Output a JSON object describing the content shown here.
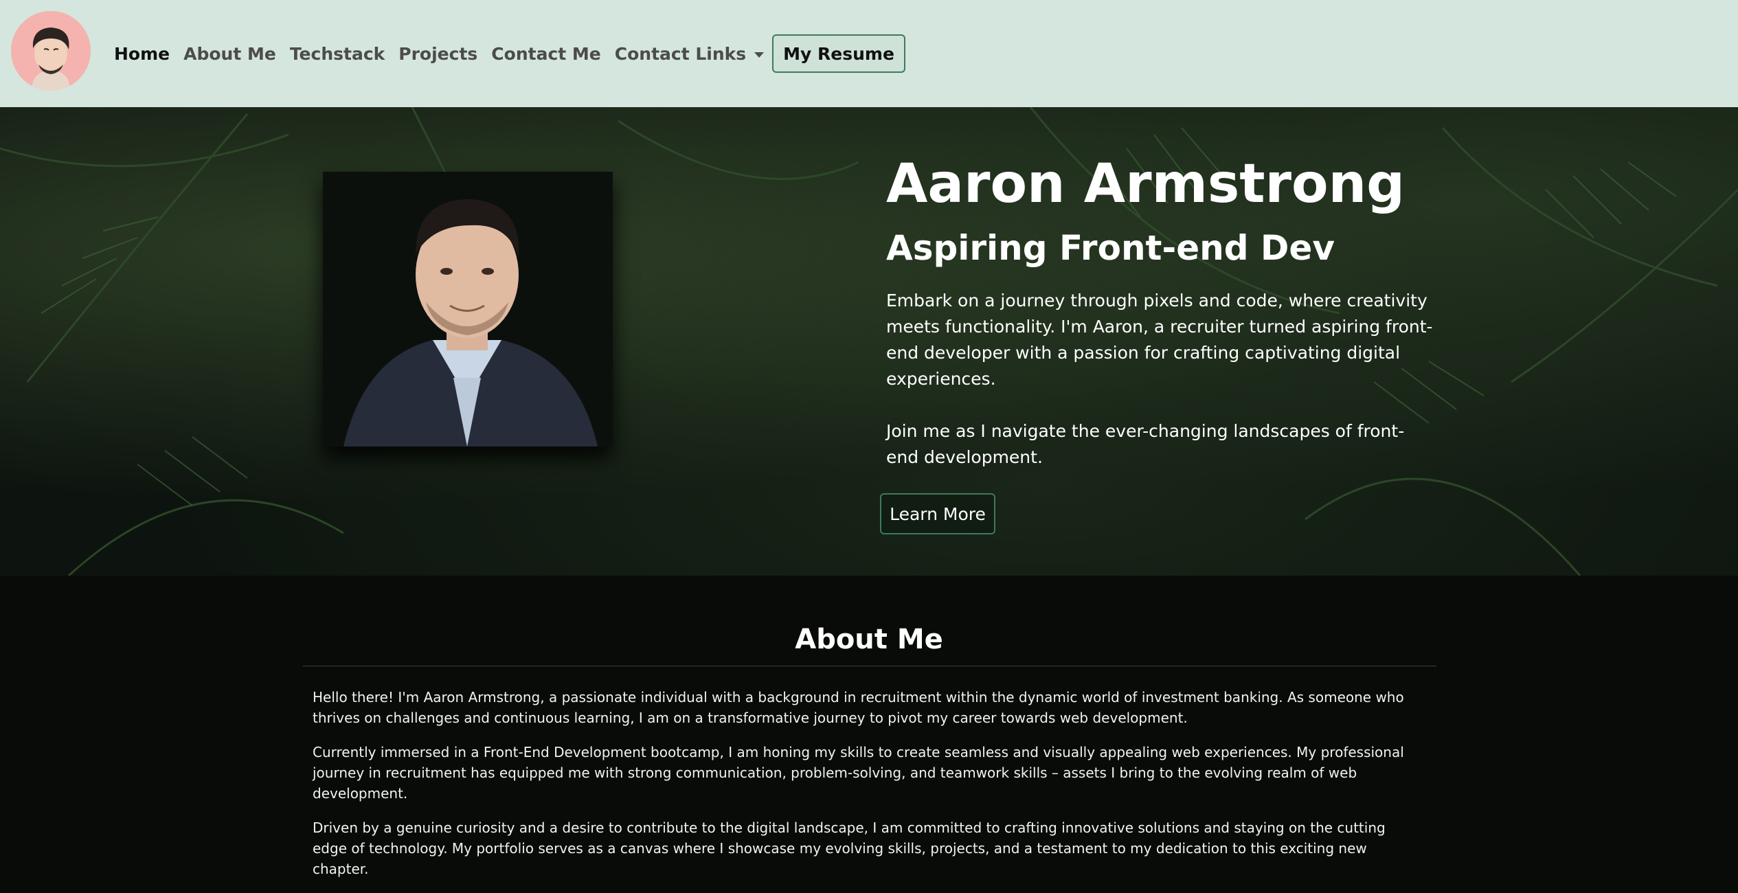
{
  "nav": {
    "avatar_icon": "memoji-avatar-icon",
    "links": [
      {
        "label": "Home",
        "active": true
      },
      {
        "label": "About Me"
      },
      {
        "label": "Techstack"
      },
      {
        "label": "Projects"
      },
      {
        "label": "Contact Me"
      }
    ],
    "dropdown_label": "Contact Links",
    "resume_label": "My Resume"
  },
  "hero": {
    "name": "Aaron Armstrong",
    "title": "Aspiring Front-end Dev",
    "intro": "Embark on a journey through pixels and code, where creativity meets functionality. I'm Aaron, a recruiter turned aspiring front-end developer with a passion for crafting captivating digital experiences.",
    "invite": "Join me as I navigate the ever-changing landscapes of front-end development.",
    "button_label": "Learn More"
  },
  "about": {
    "heading": "About Me",
    "paragraphs": [
      "Hello there! I'm Aaron Armstrong, a passionate individual with a background in recruitment within the dynamic world of investment banking. As someone who thrives on challenges and continuous learning, I am on a transformative journey to pivot my career towards web development.",
      "Currently immersed in a Front-End Development bootcamp, I am honing my skills to create seamless and visually appealing web experiences. My professional journey in recruitment has equipped me with strong communication, problem-solving, and teamwork skills – assets I bring to the evolving realm of web development.",
      "Driven by a genuine curiosity and a desire to contribute to the digital landscape, I am committed to crafting innovative solutions and staying on the cutting edge of technology. My portfolio serves as a canvas where I showcase my evolving skills, projects, and a testament to my dedication to this exciting new chapter."
    ]
  }
}
